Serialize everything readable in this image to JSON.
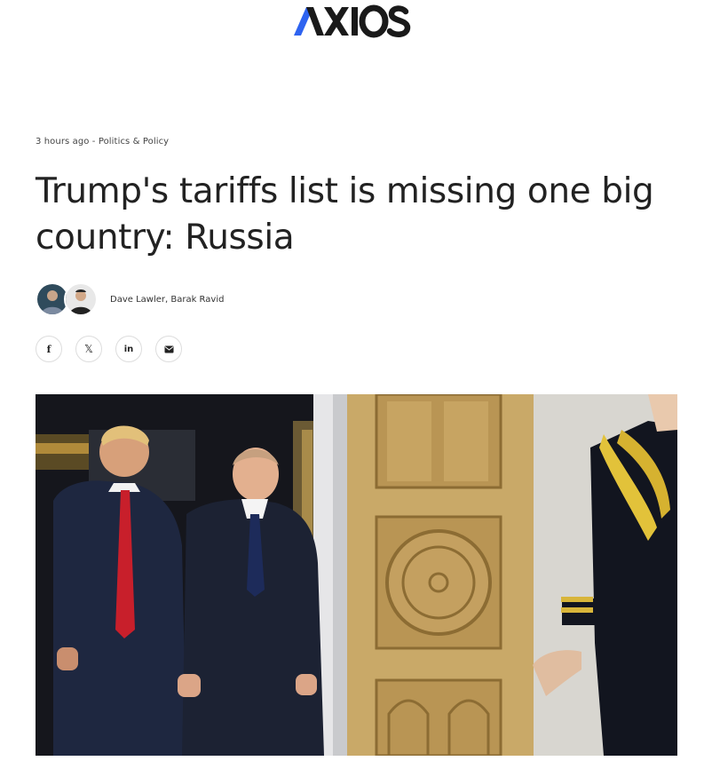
{
  "brand": {
    "name": "AXIOS",
    "accent": "#2e63f0",
    "ink": "#1a1a1a"
  },
  "article": {
    "timestamp": "3 hours ago",
    "separator": " - ",
    "category": "Politics & Policy",
    "headline": "Trump's tariffs list is missing one big country: Russia",
    "authors": "Dave Lawler, Barak Ravid"
  },
  "share": [
    {
      "icon": "facebook-icon",
      "glyph": "f"
    },
    {
      "icon": "x-icon",
      "glyph": "𝕏"
    },
    {
      "icon": "linkedin-icon",
      "glyph": "in"
    },
    {
      "icon": "email-icon",
      "glyph": ""
    }
  ]
}
